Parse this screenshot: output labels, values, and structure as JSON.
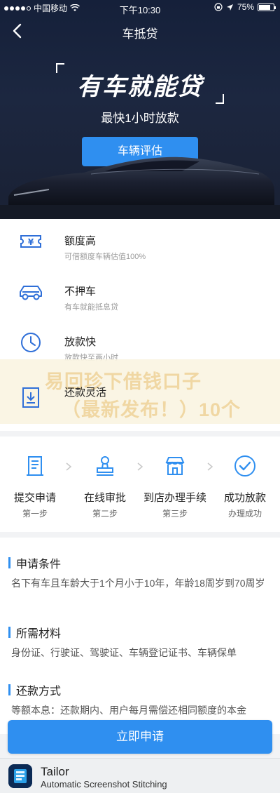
{
  "status_bar": {
    "carrier": "中国移动",
    "time": "下午10:30",
    "battery": "75%"
  },
  "nav": {
    "title": "车抵贷"
  },
  "hero": {
    "slogan": "有车就能贷",
    "subslogan": "最快1小时放款",
    "eval_button": "车辆评估"
  },
  "features": [
    {
      "title": "额度高",
      "desc": "可借额度车辆估值100%",
      "icon": "yen-ticket-icon"
    },
    {
      "title": "不押车",
      "desc": "有车就能抵息贷",
      "icon": "car-icon"
    },
    {
      "title": "放款快",
      "desc": "放款快至两小时",
      "icon": "clock-icon"
    },
    {
      "title": "还款灵活",
      "desc": "",
      "icon": "document-download-icon"
    }
  ],
  "overlay": {
    "line1": "易回珍下借钱口子",
    "line2": "（最新发布！）10个"
  },
  "steps": [
    {
      "title": "提交申请",
      "sub": "第一步",
      "icon": "form-icon"
    },
    {
      "title": "在线审批",
      "sub": "第二步",
      "icon": "stamp-icon"
    },
    {
      "title": "到店办理手续",
      "sub": "第三步",
      "icon": "store-icon"
    },
    {
      "title": "成功放款",
      "sub": "办理成功",
      "icon": "check-circle-icon"
    }
  ],
  "info": {
    "conditions_title": "申请条件",
    "conditions_body": "名下有车且车龄大于1个月小于10年，年龄18周岁到70周岁",
    "materials_title": "所需材料",
    "materials_body": "身份证、行驶证、驾驶证、车辆登记证书、车辆保单",
    "repay_title": "还款方式",
    "repay_body": "等额本息：还款期内、用户每月需偿还相同额度的本金"
  },
  "apply_button": "立即申请",
  "footer": {
    "app_name": "Tailor",
    "app_desc": "Automatic Screenshot Stitching"
  },
  "colors": {
    "accent": "#2f8ff0",
    "hero_bg": "#1a2134"
  }
}
